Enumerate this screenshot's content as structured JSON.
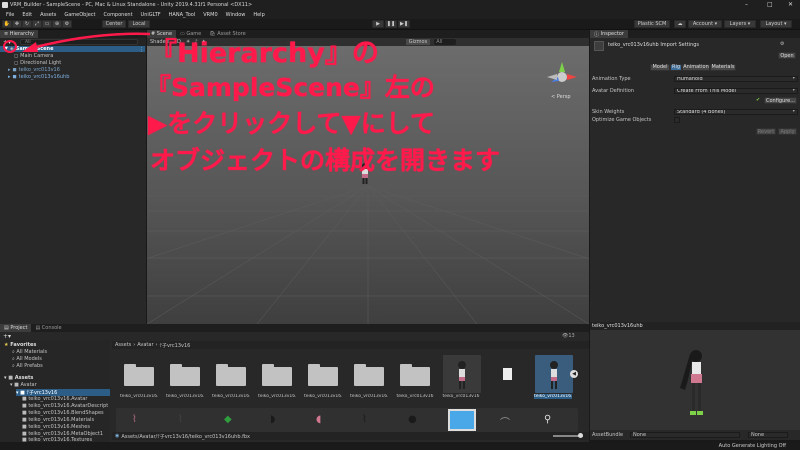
{
  "titlebar": {
    "title": "VRM_Builder - SampleScene - PC, Mac & Linux Standalone - Unity 2019.4.31f1 Personal <DX11>"
  },
  "menu": [
    "File",
    "Edit",
    "Assets",
    "GameObject",
    "Component",
    "UniGLTF",
    "HANA_Tool",
    "VRM0",
    "Window",
    "Help"
  ],
  "toolbar": {
    "center": "Center",
    "local": "Local",
    "plastic": "Plastic SCM",
    "account": "Account",
    "layers": "Layers",
    "layout": "Layout"
  },
  "hierarchy": {
    "tab": "Hierarchy",
    "search_placeholder": "All",
    "scene": "SampleScene",
    "items": [
      "Main Camera",
      "Directional Light",
      "teiko_vrc013v16",
      "teiko_vrc013v16uhb"
    ]
  },
  "scene_view": {
    "tabs": [
      "Scene",
      "Game",
      "Asset Store"
    ],
    "shading": "Shaded",
    "mode": "2D",
    "gizmos": "Gizmos",
    "search": "All",
    "persp": "< Persp"
  },
  "annotation": {
    "line1": "『Hierarchy』の",
    "line2": "『SampleScene』左の",
    "line3": "▶をクリックして▼にして",
    "line4": "オブジェクトの構成を開きます",
    "color": "#ff1a4b"
  },
  "inspector": {
    "tab": "Inspector",
    "asset_title": "teiko_vrc013v16uhb Import Settings",
    "open": "Open",
    "subtabs": [
      "Model",
      "Rig",
      "Animation",
      "Materials"
    ],
    "fields": [
      {
        "label": "Animation Type",
        "value": "Humanoid"
      },
      {
        "label": "Avatar Definition",
        "value": "Create From This Model"
      },
      {
        "label": "Skin Weights",
        "value": "Standard (4 Bones)"
      }
    ],
    "configure": "Configure...",
    "optimize": "Optimize Game Objects",
    "revert": "Revert",
    "apply": "Apply",
    "preview_title": "teiko_vrc013v16uhb",
    "assetbundle_label": "AssetBundle",
    "assetbundle_value": "None",
    "assetbundle_variant": "None"
  },
  "project": {
    "tabs": [
      "Project",
      "Console"
    ],
    "favorites": "Favorites",
    "fav_items": [
      "All Materials",
      "All Models",
      "All Prefabs"
    ],
    "assets": "Assets",
    "tree": [
      "Avatar",
      "ﾃ子vrc13v16",
      "teiko_vrc013v16.Avatar",
      "teiko_vrc013v16.AvatarDescript",
      "teiko_vrc013v16.BlendShapes",
      "teiko_vrc013v16.Materials",
      "teiko_vrc013v16.Meshes",
      "teiko_vrc013v16.MetaObject1",
      "teiko_vrc013v16.Textures"
    ],
    "breadcrumb": [
      "Assets",
      "Avatar",
      "ﾃ子vrc13v16"
    ],
    "count": "13",
    "grid": [
      "teiko_vrc013v16....",
      "teiko_vrc013v16....",
      "teiko_vrc013v16....",
      "teiko_vrc013v16....",
      "teiko_vrc013v16....",
      "teiko_vrc013v16....",
      "teiko_vrc013v16",
      "teiko_vrc013v16",
      "teiko_vrc013v16..."
    ],
    "path": "Assets/Avatar/ﾃ子vrc13v16/teiko_vrc013v16uhb.fbx"
  },
  "statusbar": {
    "text": "Auto Generate Lighting Off"
  }
}
